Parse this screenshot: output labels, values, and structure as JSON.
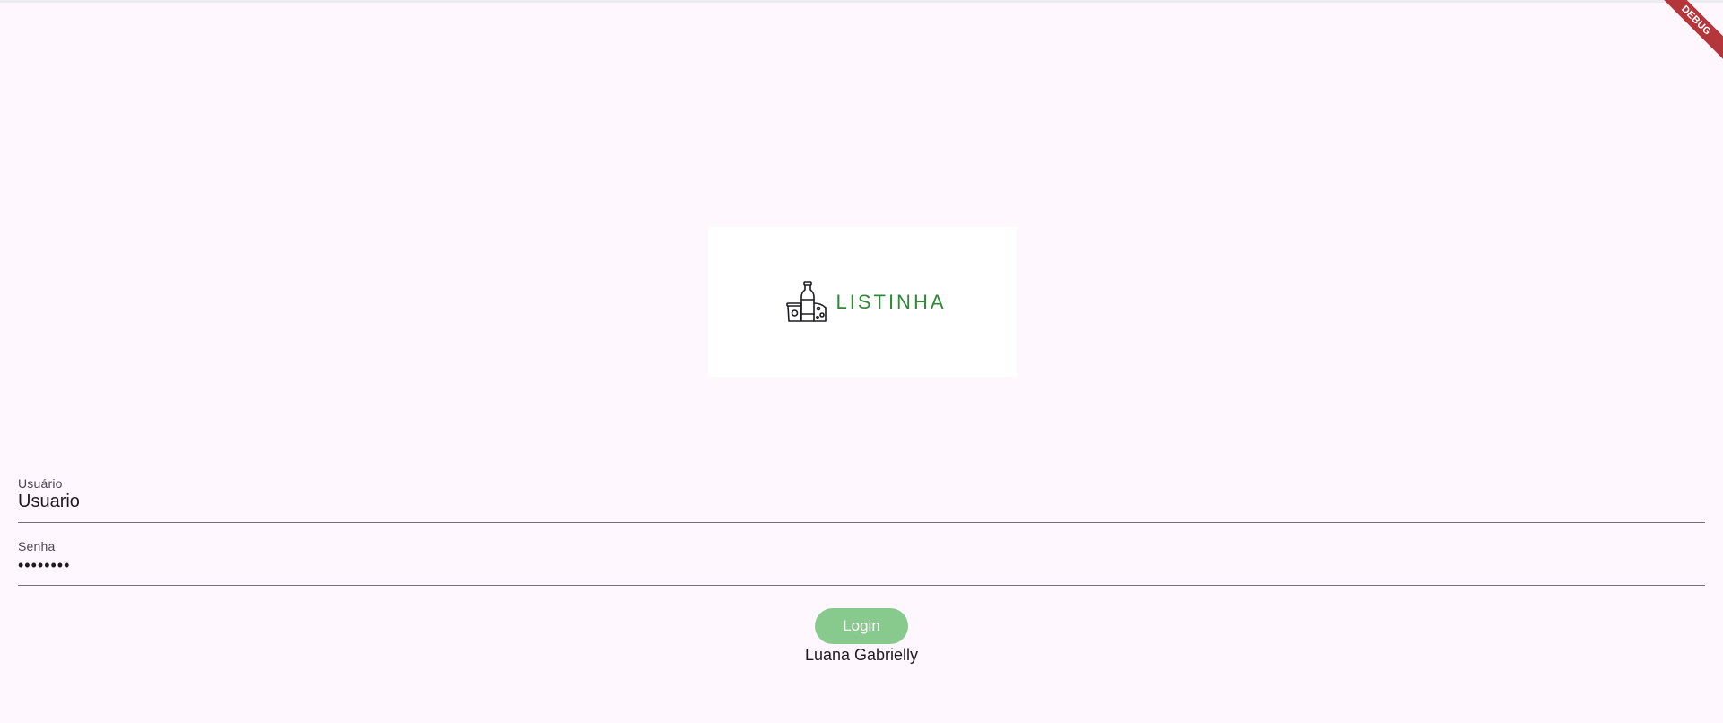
{
  "app": {
    "logo_text": "LISTINHA",
    "logo_icon": "grocery-items-icon",
    "brand_color": "#2f8a38"
  },
  "form": {
    "username": {
      "label": "Usuário",
      "value": "Usuario"
    },
    "password": {
      "label": "Senha",
      "value": "••••••••"
    },
    "login_label": "Login",
    "login_color": "#88c98e"
  },
  "footer": {
    "author": "Luana Gabrielly"
  },
  "debug_banner": {
    "label": "DEBUG",
    "color": "#b5363a"
  }
}
